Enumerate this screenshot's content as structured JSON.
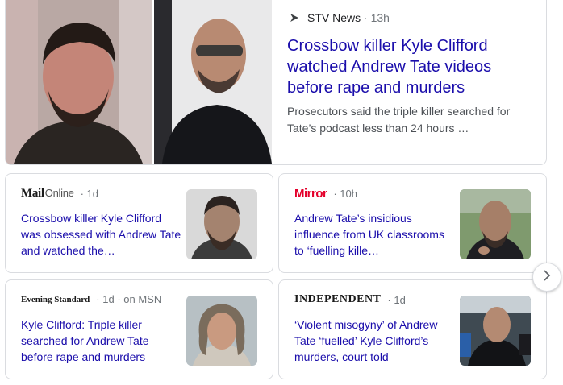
{
  "top_story": {
    "source": "STV News",
    "age": "13h",
    "headline": "Crossbow killer Kyle Clifford watched Andrew Tate videos before rape and murders",
    "snippet": "Prosecutors said the triple killer searched for Tate’s podcast less than 24 hours …"
  },
  "stories": [
    {
      "logo_main": "Mail",
      "logo_sub": "Online",
      "age": "1d",
      "headline": "Crossbow killer Kyle Clifford was obsessed with Andrew Tate and watched the…"
    },
    {
      "logo_main": "Mirror",
      "age": "10h",
      "headline": "Andrew Tate’s insidious influence from UK classrooms to ‘fuelling kille…"
    },
    {
      "logo_main": "Evening Standard",
      "age": "1d",
      "on": "on MSN",
      "headline": "Kyle Clifford: Triple killer searched for Andrew Tate before rape and murders"
    },
    {
      "logo_main": "INDEPENDENT",
      "age": "1d",
      "headline": "‘Violent misogyny’ of Andrew Tate ‘fuelled’ Kyle Clifford’s murders, court told"
    }
  ],
  "icons": {
    "next": "chevron-right-icon",
    "source": "stv-logo-icon"
  }
}
